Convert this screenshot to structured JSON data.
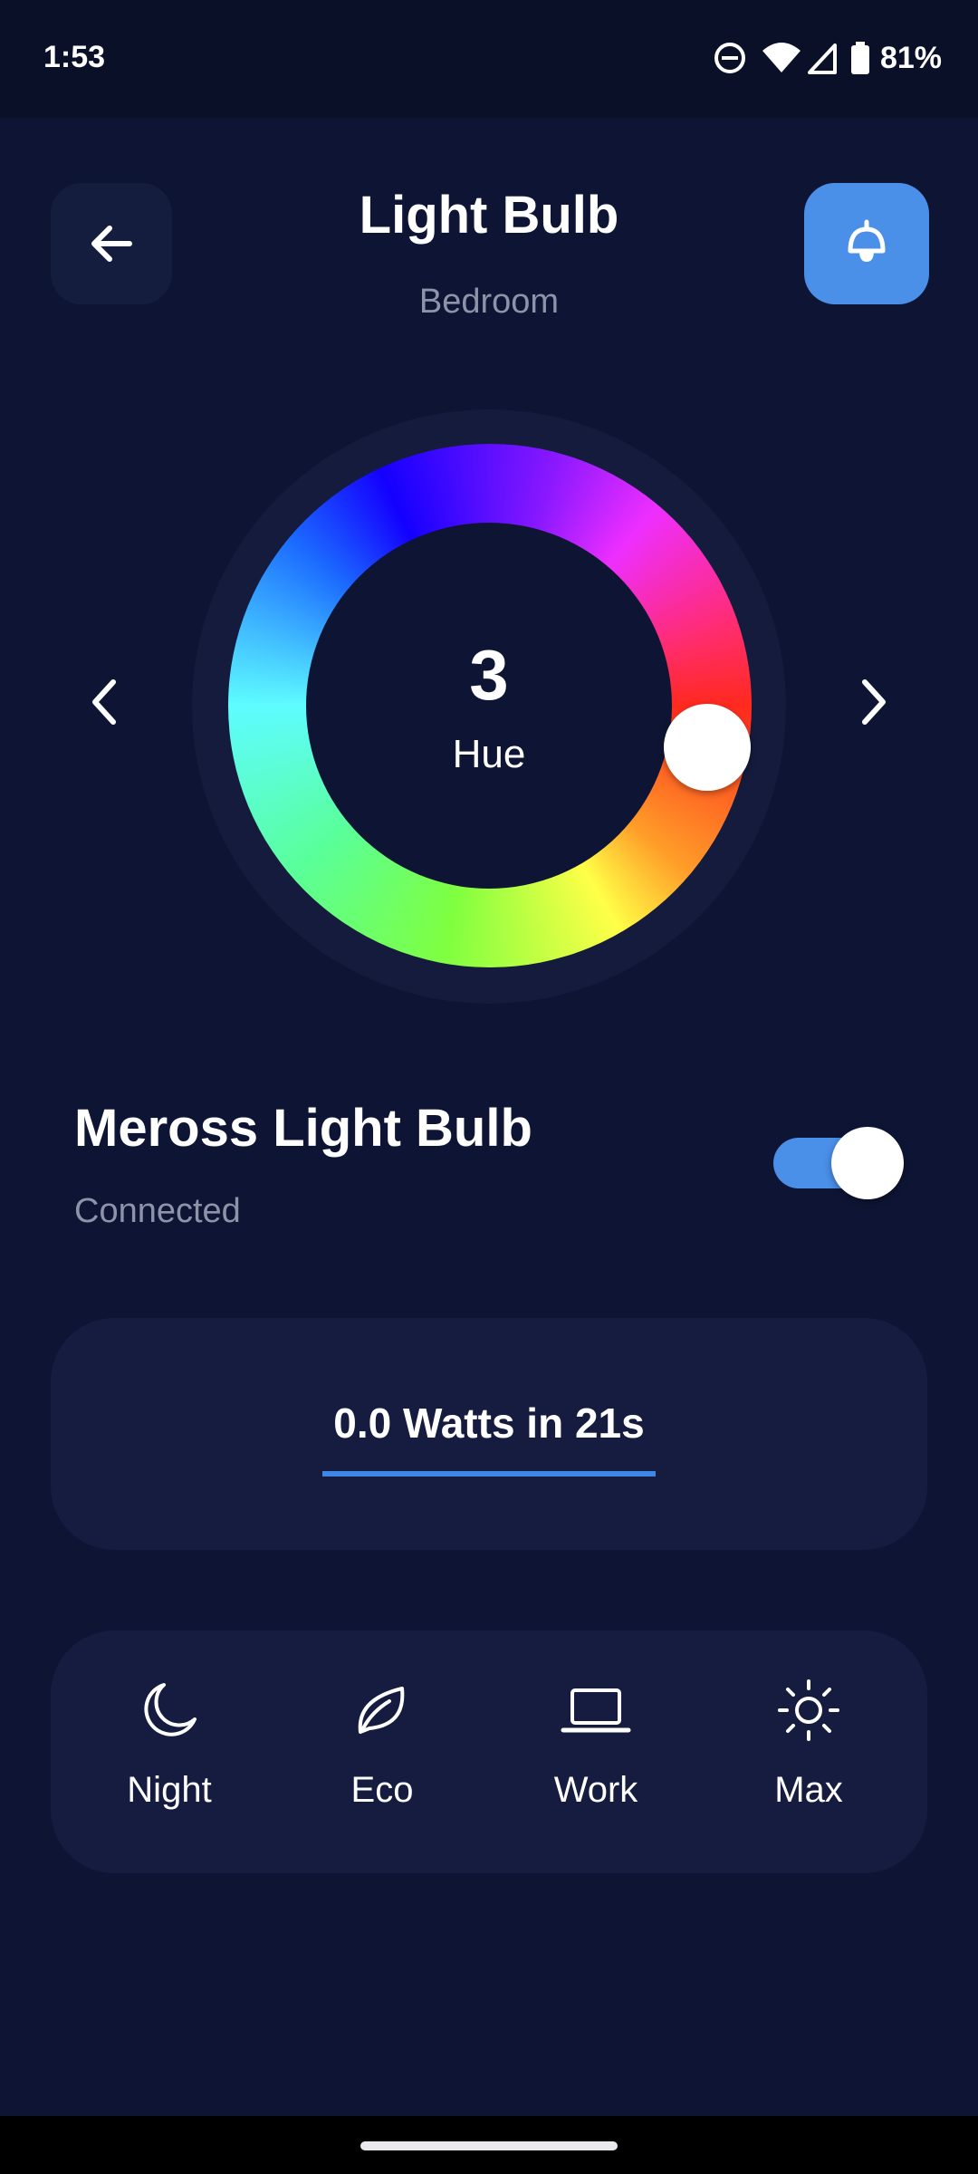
{
  "status_bar": {
    "time": "1:53",
    "battery": "81%"
  },
  "header": {
    "title": "Light Bulb",
    "subtitle": "Bedroom"
  },
  "color_wheel": {
    "value": "3",
    "label": "Hue"
  },
  "device": {
    "name": "Meross Light Bulb",
    "status": "Connected",
    "power_on": true
  },
  "energy": {
    "text": "0.0 Watts in 21s"
  },
  "modes": [
    {
      "label": "Night",
      "icon": "moon-icon"
    },
    {
      "label": "Eco",
      "icon": "leaf-icon"
    },
    {
      "label": "Work",
      "icon": "laptop-icon"
    },
    {
      "label": "Max",
      "icon": "sun-icon"
    }
  ],
  "colors": {
    "background": "#0e1534",
    "card": "#151c3f",
    "accent": "#4a8fe8",
    "muted_text": "#8d93a8"
  }
}
